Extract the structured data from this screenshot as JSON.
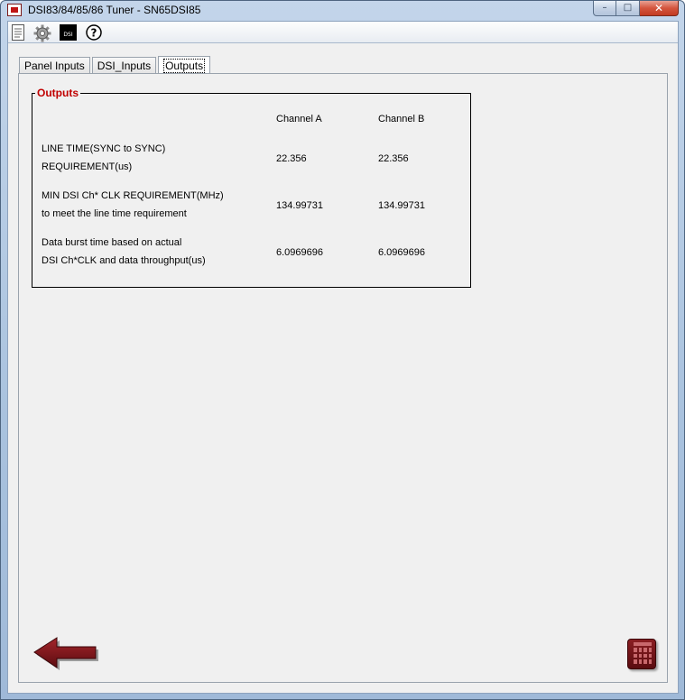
{
  "window": {
    "title": "DSI83/84/85/86 Tuner - SN65DSI85",
    "minimize": "–",
    "maximize": "□",
    "close": "✕"
  },
  "toolbar": {
    "icons": [
      "document-icon",
      "gear-icon",
      "dsi-icon",
      "help-icon"
    ],
    "dsi_label": "DSI"
  },
  "tabs": [
    {
      "label": "Panel Inputs",
      "active": false
    },
    {
      "label": "DSI_Inputs",
      "active": false
    },
    {
      "label": "Outputs",
      "active": true
    }
  ],
  "outputs": {
    "group_title": "Outputs",
    "headers": {
      "channel_a": "Channel A",
      "channel_b": "Channel B"
    },
    "rows": [
      {
        "label_line1": "LINE TIME(SYNC to SYNC)",
        "label_line2": "REQUIREMENT(us)",
        "channel_a": "22.356",
        "channel_b": "22.356"
      },
      {
        "label_line1": "MIN DSI Ch* CLK REQUIREMENT(MHz)",
        "label_line2": "to meet the line time requirement",
        "channel_a": "134.99731",
        "channel_b": "134.99731"
      },
      {
        "label_line1": "Data burst time based on actual",
        "label_line2": "DSI Ch*CLK and data throughput(us)",
        "channel_a": "6.0969696",
        "channel_b": "6.0969696"
      }
    ]
  },
  "colors": {
    "group_title": "#c00000",
    "back_arrow": "#8a1a1e",
    "calculator": "#7a1519"
  }
}
